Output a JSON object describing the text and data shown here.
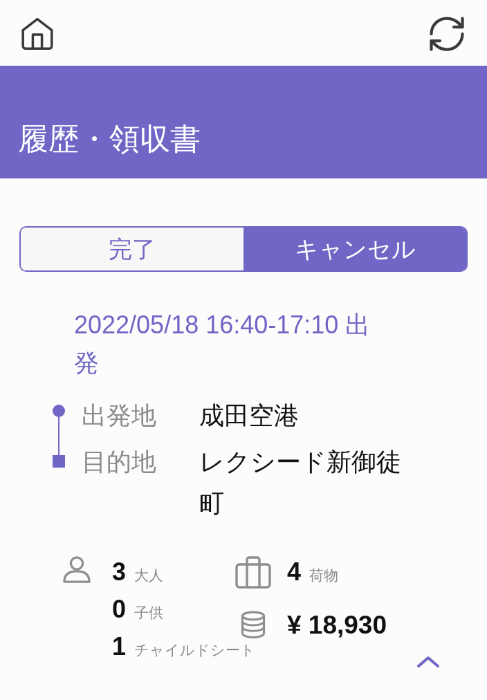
{
  "header": {
    "title": "履歴・領収書"
  },
  "tabs": [
    {
      "label": "完了",
      "selected": false
    },
    {
      "label": "キャンセル",
      "selected": true
    }
  ],
  "trip": {
    "datetime": "2022/05/18 16:40-17:10 出発",
    "route": [
      {
        "kind": "origin",
        "label": "出発地",
        "place": "成田空港"
      },
      {
        "kind": "destination",
        "label": "目的地",
        "place": "レクシード新御徒町"
      }
    ],
    "passengers": [
      {
        "count": "3",
        "label": "大人"
      },
      {
        "count": "0",
        "label": "子供"
      },
      {
        "count": "1",
        "label": "チャイルドシート"
      }
    ],
    "luggage": {
      "count": "4",
      "label": "荷物"
    },
    "fare": "¥ 18,930"
  }
}
